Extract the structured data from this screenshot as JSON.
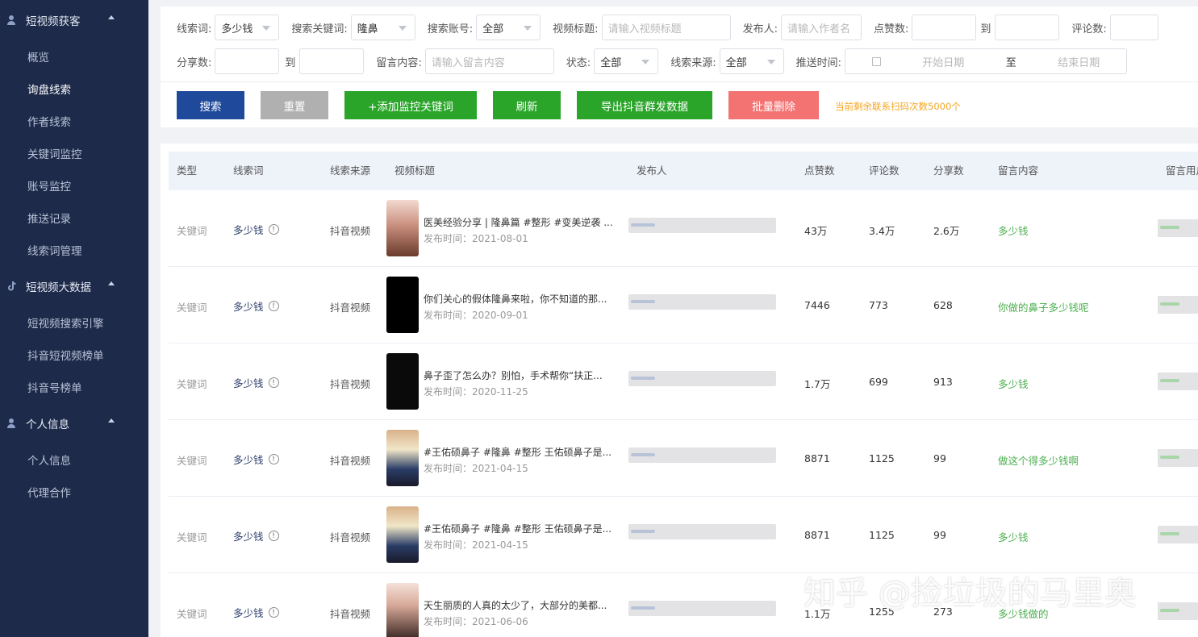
{
  "sidebar": {
    "groups": [
      {
        "label": "短视频获客",
        "items": [
          "概览",
          "询盘线索",
          "作者线索",
          "关键词监控",
          "账号监控",
          "推送记录",
          "线索词管理"
        ]
      },
      {
        "label": "短视频大数据",
        "items": [
          "短视频搜索引擎",
          "抖音短视频榜单",
          "抖音号榜单"
        ]
      },
      {
        "label": "个人信息",
        "items": [
          "个人信息",
          "代理合作"
        ]
      }
    ],
    "active_item": "询盘线索"
  },
  "filters": {
    "row1": {
      "clue_word_label": "线索词:",
      "clue_word_value": "多少钱",
      "search_kw_label": "搜索关键词:",
      "search_kw_value": "隆鼻",
      "search_acct_label": "搜索账号:",
      "search_acct_value": "全部",
      "video_title_label": "视频标题:",
      "video_title_placeholder": "请输入视频标题",
      "publisher_label": "发布人:",
      "publisher_placeholder": "请输入作者名",
      "likes_label": "点赞数:",
      "to_label": "到",
      "comments_label": "评论数:"
    },
    "row2": {
      "shares_label": "分享数:",
      "to_label": "到",
      "message_label": "留言内容:",
      "message_placeholder": "请输入留言内容",
      "status_label": "状态:",
      "status_value": "全部",
      "source_label": "线索来源:",
      "source_value": "全部",
      "push_time_label": "推送时间:",
      "start_placeholder": "开始日期",
      "range_sep": "至",
      "end_placeholder": "结束日期"
    }
  },
  "buttons": {
    "search": "搜索",
    "reset": "重置",
    "add_monitor": "+添加监控关键词",
    "refresh": "刷新",
    "export": "导出抖音群发数据",
    "batch_delete": "批量删除",
    "notice": "当前剩余联系扫码次数5000个"
  },
  "colors": {
    "sidebar_bg": "#1d2a4a",
    "primary": "#1f4a9c",
    "green": "#2aa52a",
    "danger": "#f37272",
    "gray": "#b0b0b0",
    "notice": "#f5a623",
    "message_green": "#4caf50"
  },
  "table": {
    "headers": [
      "类型",
      "线索词",
      "线索来源",
      "视频标题",
      "发布人",
      "点赞数",
      "评论数",
      "分享数",
      "留言内容",
      "留言用户"
    ],
    "rows": [
      {
        "type": "关键词",
        "keyword": "多少钱",
        "source": "抖音视频",
        "title": "医美经验分享 | 隆鼻篇 #整形 #变美逆袭 ...",
        "date": "发布时间：2021-08-01",
        "likes": "43万",
        "comments": "3.4万",
        "shares": "2.6万",
        "message": "多少钱"
      },
      {
        "type": "关键词",
        "keyword": "多少钱",
        "source": "抖音视频",
        "title": "你们关心的假体隆鼻来啦，你不知道的那...",
        "date": "发布时间：2020-09-01",
        "likes": "7446",
        "comments": "773",
        "shares": "628",
        "message": "你做的鼻子多少钱呢"
      },
      {
        "type": "关键词",
        "keyword": "多少钱",
        "source": "抖音视频",
        "title": "鼻子歪了怎么办？别怕，手术帮你“扶正...",
        "date": "发布时间：2020-11-25",
        "likes": "1.7万",
        "comments": "699",
        "shares": "913",
        "message": "多少钱"
      },
      {
        "type": "关键词",
        "keyword": "多少钱",
        "source": "抖音视频",
        "title": "#王佑硕鼻子 #隆鼻 #整形 王佑硕鼻子是...",
        "date": "发布时间：2021-04-15",
        "likes": "8871",
        "comments": "1125",
        "shares": "99",
        "message": "做这个得多少钱啊"
      },
      {
        "type": "关键词",
        "keyword": "多少钱",
        "source": "抖音视频",
        "title": "#王佑硕鼻子 #隆鼻 #整形 王佑硕鼻子是...",
        "date": "发布时间：2021-04-15",
        "likes": "8871",
        "comments": "1125",
        "shares": "99",
        "message": "多少钱"
      },
      {
        "type": "关键词",
        "keyword": "多少钱",
        "source": "抖音视频",
        "title": "天生丽质的人真的太少了，大部分的美都...",
        "date": "发布时间：2021-06-06",
        "likes": "1.1万",
        "comments": "1255",
        "shares": "273",
        "message": "多少钱做的"
      }
    ]
  },
  "watermark": "知乎 @捡垃圾的马里奥"
}
